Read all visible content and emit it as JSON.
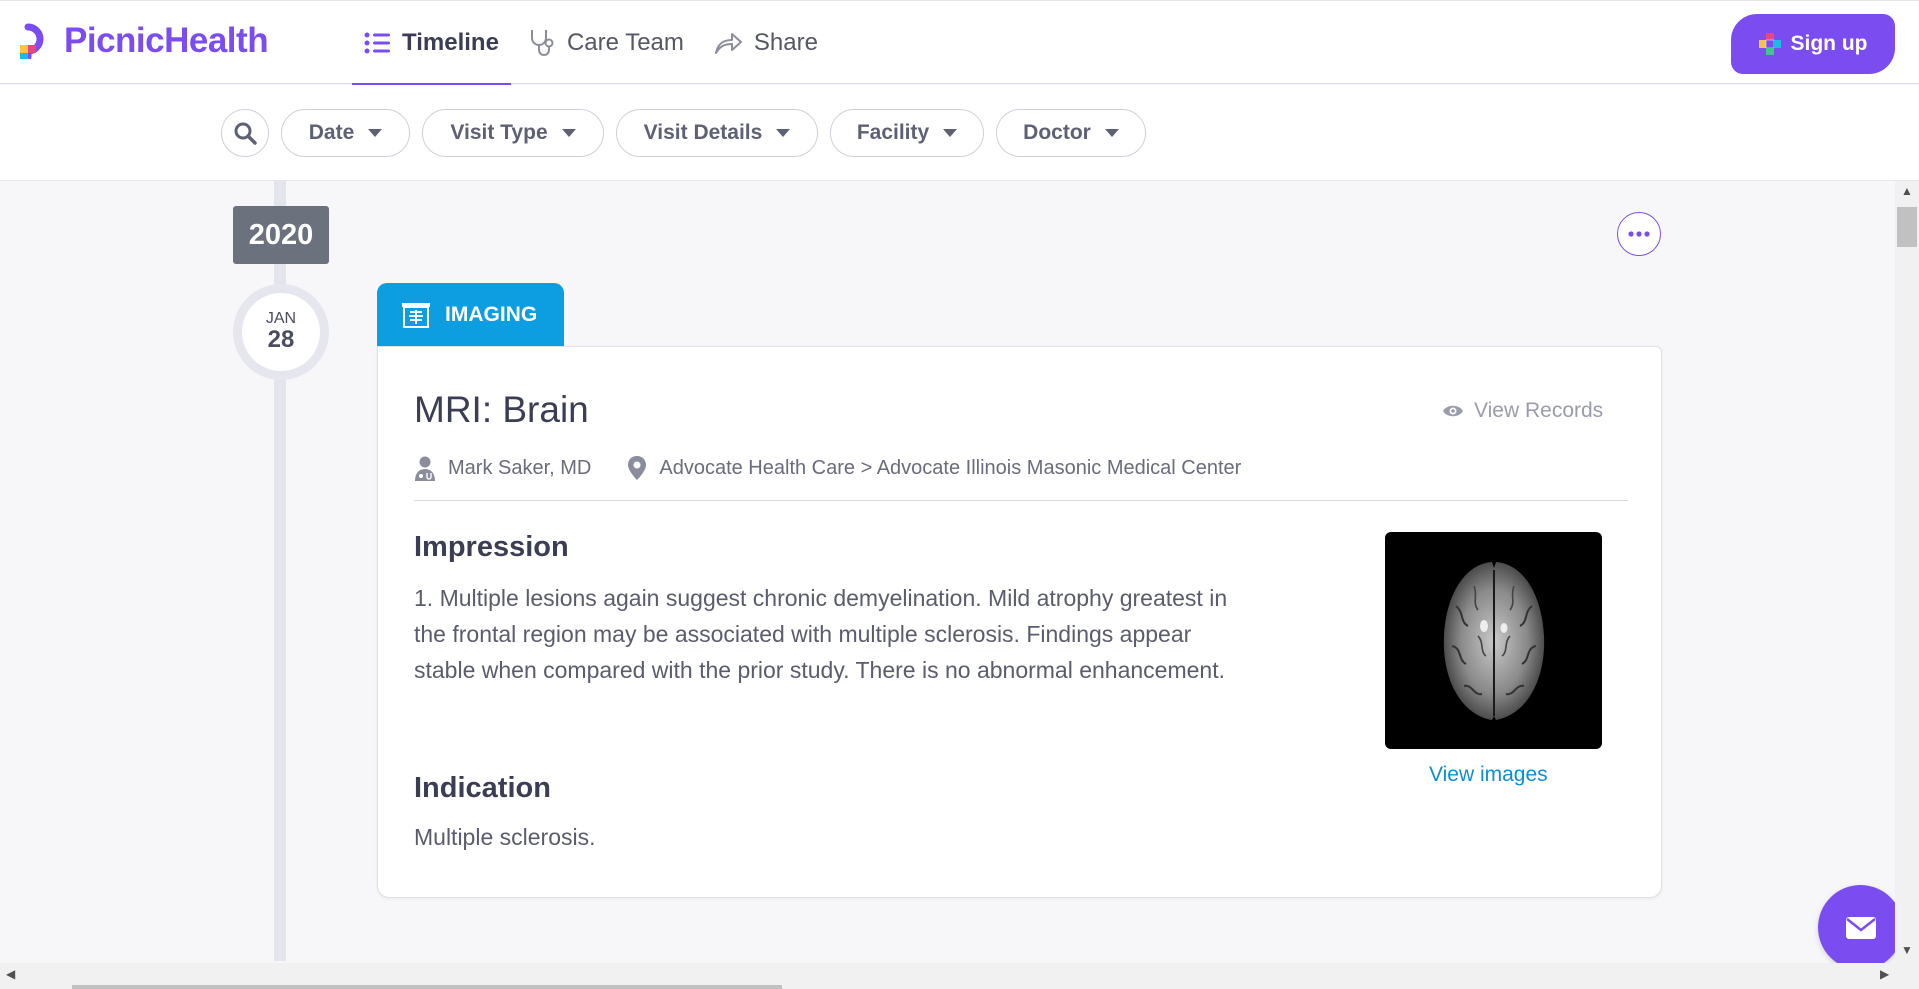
{
  "header": {
    "brand": "PicnicHealth",
    "nav": [
      {
        "label": "Timeline",
        "icon": "list-icon",
        "active": true
      },
      {
        "label": "Care Team",
        "icon": "stethoscope-icon",
        "active": false
      },
      {
        "label": "Share",
        "icon": "share-arrow-icon",
        "active": false
      }
    ],
    "signup_label": "Sign up"
  },
  "filters": {
    "search_icon": "search-icon",
    "pills": [
      "Date",
      "Visit Type",
      "Visit Details",
      "Facility",
      "Doctor"
    ]
  },
  "timeline": {
    "year": "2020",
    "month": "JAN",
    "day": "28"
  },
  "record": {
    "category": "IMAGING",
    "title": "MRI: Brain",
    "view_records": "View Records",
    "doctor": "Mark Saker, MD",
    "location": "Advocate Health Care > Advocate Illinois Masonic Medical Center",
    "impression_heading": "Impression",
    "impression_text": "1. Multiple lesions again suggest chronic demyelination. Mild atrophy greatest in the frontal region may be associated with multiple sclerosis. Findings appear stable when compared with the prior study. There is no abnormal enhancement.",
    "indication_heading": "Indication",
    "indication_text": "Multiple sclerosis.",
    "view_images": "View images"
  },
  "colors": {
    "brand": "#7b4cf0",
    "imaging": "#0c9ee0",
    "link": "#0c8fd3",
    "year_badge": "#6c727d"
  }
}
